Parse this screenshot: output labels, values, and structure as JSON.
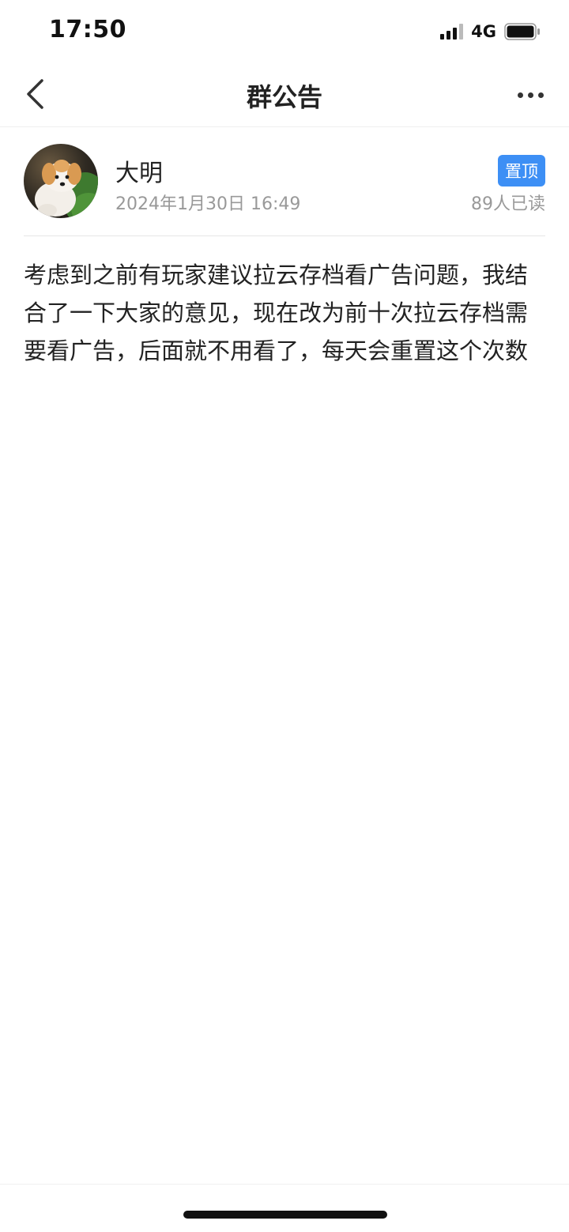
{
  "status_bar": {
    "time": "17:50",
    "network": "4G",
    "icons": [
      "signal-icon",
      "battery-icon"
    ]
  },
  "nav": {
    "title": "群公告",
    "icons": [
      "back-chevron-icon",
      "more-dots-icon"
    ]
  },
  "announcement": {
    "author_name": "大明",
    "timestamp": "2024年1月30日 16:49",
    "pin_label": "置顶",
    "read_count": "89人已读",
    "body": "考虑到之前有玩家建议拉云存档看广告问题，我结合了一下大家的意见，现在改为前十次拉云存档需要看广告，后面就不用看了，每天会重置这个次数"
  },
  "colors": {
    "accent": "#3d8ff5",
    "secondary_text": "#999999",
    "primary_text": "#222222"
  }
}
